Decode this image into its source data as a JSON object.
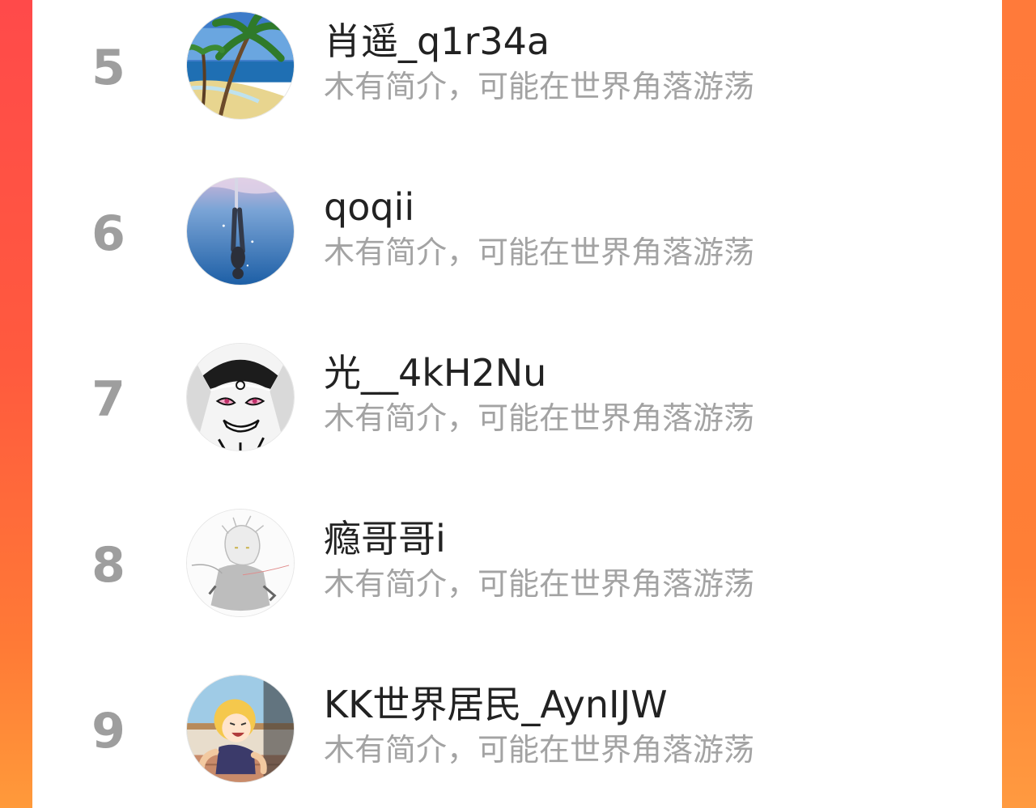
{
  "ranking_list": {
    "items": [
      {
        "rank": "5",
        "name": "肖遥_q1r34a",
        "bio": "木有简介，可能在世界角落游荡",
        "avatar_icon": "beach-palm-avatar-icon"
      },
      {
        "rank": "6",
        "name": "qoqii",
        "bio": "木有简介，可能在世界角落游荡",
        "avatar_icon": "diver-underwater-avatar-icon"
      },
      {
        "rank": "7",
        "name": "光__4kH2Nu",
        "bio": "木有简介，可能在世界角落游荡",
        "avatar_icon": "manga-character-avatar-icon"
      },
      {
        "rank": "8",
        "name": "瘾哥哥i",
        "bio": "木有简介，可能在世界角落游荡",
        "avatar_icon": "sketch-character-avatar-icon"
      },
      {
        "rank": "9",
        "name": "KK世界居民_AynIJW",
        "bio": "木有简介，可能在世界角落游荡",
        "avatar_icon": "anime-crying-avatar-icon"
      }
    ]
  },
  "colors": {
    "background_gradient_top": "#ff4a4a",
    "background_gradient_bottom": "#ff9a3a",
    "card": "#ffffff",
    "rank_text": "#9e9e9e",
    "name_text": "#222222",
    "bio_text": "#a3a3a3"
  }
}
